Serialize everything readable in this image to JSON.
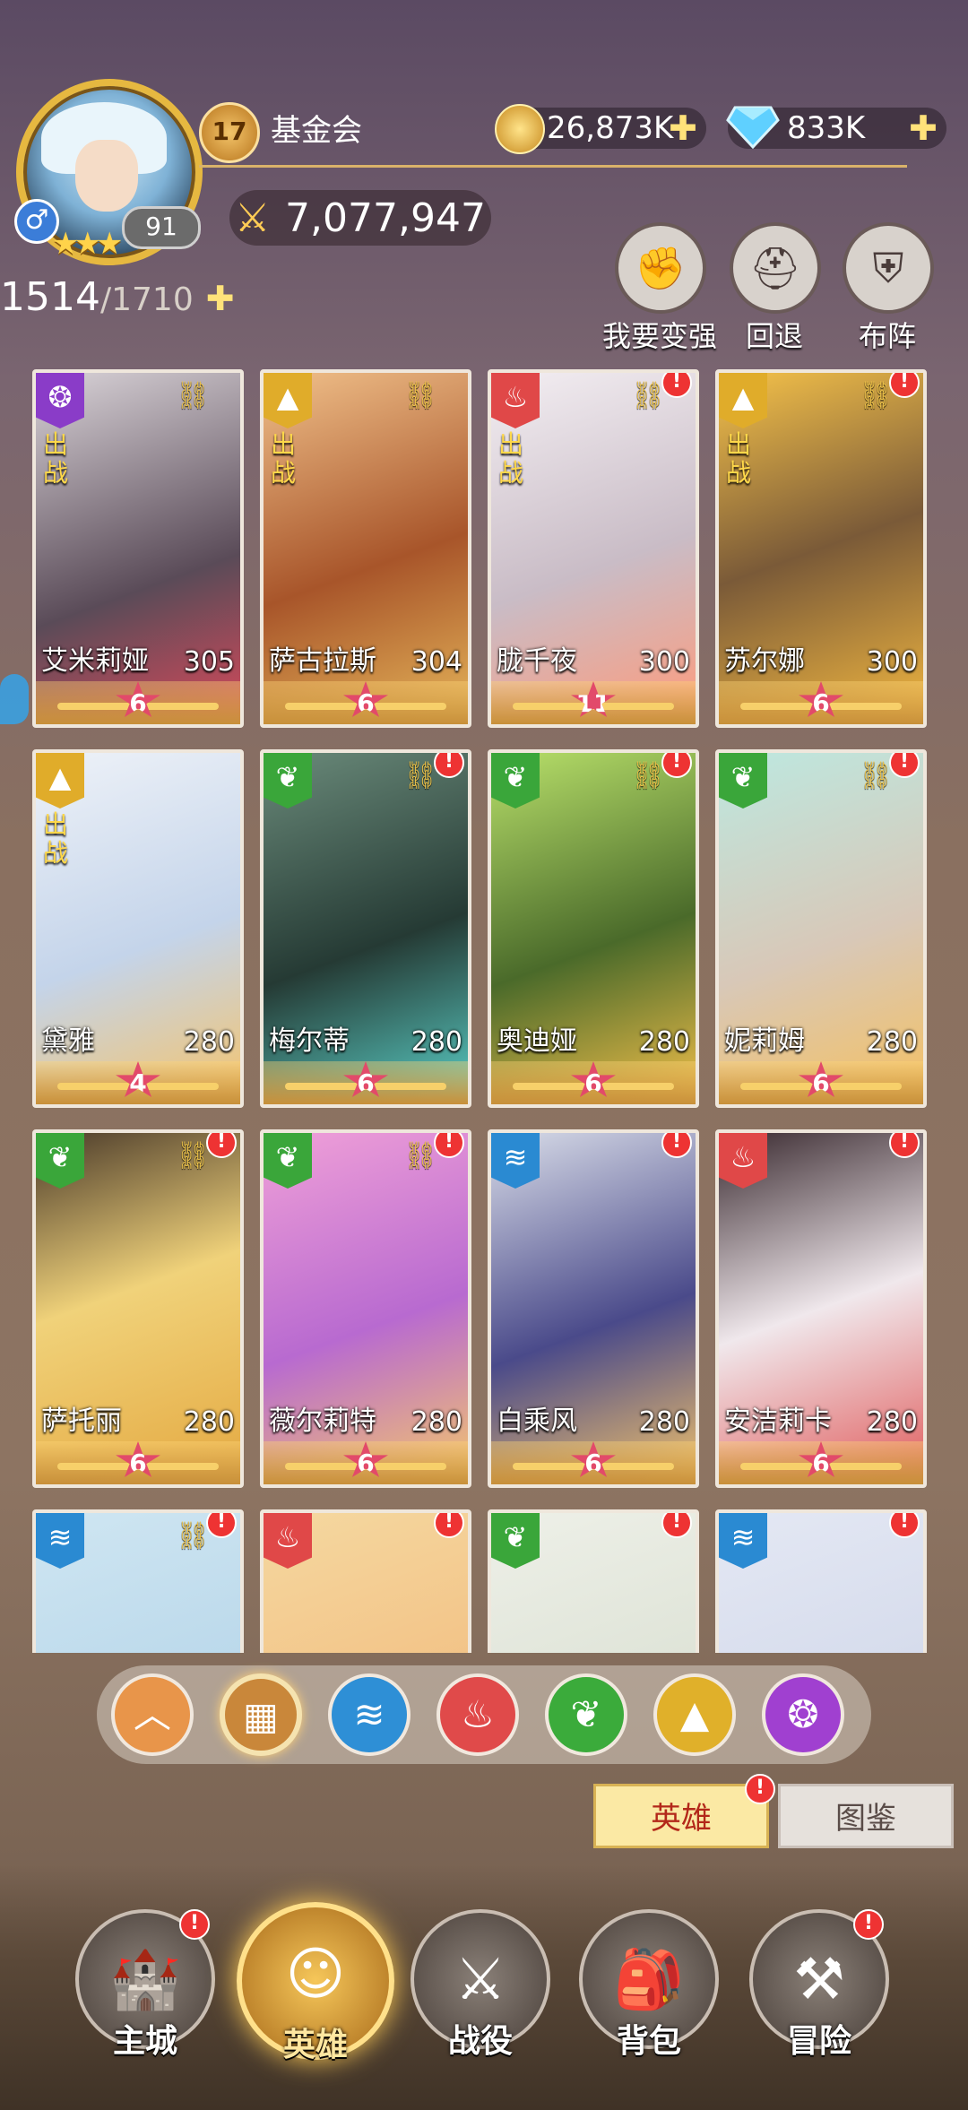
{
  "player": {
    "level": "91",
    "vip_level": "17",
    "guild": "基金会",
    "power": "7,077,947",
    "gender_icon": "male-icon"
  },
  "resources": {
    "gold": "26,873K",
    "gems": "833K"
  },
  "actions": [
    {
      "label": "我要变强",
      "icon": "fist-icon"
    },
    {
      "label": "回退",
      "icon": "helmet-reset-icon"
    },
    {
      "label": "布阵",
      "icon": "formation-shield-icon"
    }
  ],
  "capacity": {
    "current": "1514",
    "max": "/1710"
  },
  "deploy_label": "出战",
  "heroes": [
    {
      "name": "艾米莉娅",
      "level": "305",
      "stars": "6",
      "element": "dark",
      "deployed": true,
      "alert": false,
      "linked": true
    },
    {
      "name": "萨古拉斯",
      "level": "304",
      "stars": "6",
      "element": "light",
      "deployed": true,
      "alert": false,
      "linked": true
    },
    {
      "name": "胧千夜",
      "level": "300",
      "stars": "11",
      "element": "fire",
      "deployed": true,
      "alert": true,
      "linked": true
    },
    {
      "name": "苏尔娜",
      "level": "300",
      "stars": "6",
      "element": "light",
      "deployed": true,
      "alert": true,
      "linked": true
    },
    {
      "name": "黛雅",
      "level": "280",
      "stars": "4",
      "element": "light",
      "deployed": true,
      "alert": false,
      "linked": false
    },
    {
      "name": "梅尔蒂",
      "level": "280",
      "stars": "6",
      "element": "nature",
      "deployed": false,
      "alert": true,
      "linked": true
    },
    {
      "name": "奥迪娅",
      "level": "280",
      "stars": "6",
      "element": "nature",
      "deployed": false,
      "alert": true,
      "linked": true
    },
    {
      "name": "妮莉姆",
      "level": "280",
      "stars": "6",
      "element": "nature",
      "deployed": false,
      "alert": true,
      "linked": true
    },
    {
      "name": "萨托丽",
      "level": "280",
      "stars": "6",
      "element": "nature",
      "deployed": false,
      "alert": true,
      "linked": true
    },
    {
      "name": "薇尔莉特",
      "level": "280",
      "stars": "6",
      "element": "nature",
      "deployed": false,
      "alert": true,
      "linked": true
    },
    {
      "name": "白乘风",
      "level": "280",
      "stars": "6",
      "element": "water",
      "deployed": false,
      "alert": true,
      "linked": false
    },
    {
      "name": "安洁莉卡",
      "level": "280",
      "stars": "6",
      "element": "fire",
      "deployed": false,
      "alert": true,
      "linked": false
    },
    {
      "name": "",
      "level": "",
      "stars": "",
      "element": "water",
      "deployed": false,
      "alert": true,
      "linked": true
    },
    {
      "name": "",
      "level": "",
      "stars": "",
      "element": "fire",
      "deployed": false,
      "alert": true,
      "linked": false
    },
    {
      "name": "",
      "level": "",
      "stars": "",
      "element": "nature",
      "deployed": false,
      "alert": true,
      "linked": false
    },
    {
      "name": "",
      "level": "",
      "stars": "",
      "element": "water",
      "deployed": false,
      "alert": true,
      "linked": false
    }
  ],
  "filters": [
    {
      "icon": "chevron-up-icon",
      "color": "#e8954a"
    },
    {
      "icon": "grid-all-icon",
      "color": "#c9873a"
    },
    {
      "icon": "water-element-icon",
      "color": "#2e8fd6"
    },
    {
      "icon": "fire-element-icon",
      "color": "#e04a4a"
    },
    {
      "icon": "nature-element-icon",
      "color": "#3bab3b"
    },
    {
      "icon": "light-element-icon",
      "color": "#e0b02a"
    },
    {
      "icon": "dark-element-icon",
      "color": "#a040d0"
    }
  ],
  "tabs": {
    "hero": "英雄",
    "dex": "图鉴"
  },
  "nav": [
    {
      "label": "主城",
      "icon": "castle-icon",
      "alert": true
    },
    {
      "label": "英雄",
      "icon": "hero-icon",
      "alert": false,
      "active": true
    },
    {
      "label": "战役",
      "icon": "sword-wings-icon",
      "alert": false
    },
    {
      "label": "背包",
      "icon": "backpack-icon",
      "alert": false
    },
    {
      "label": "冒险",
      "icon": "sword-hammer-icon",
      "alert": true
    }
  ],
  "element_colors": {
    "dark": "#8a3cc8",
    "light": "#e0ac2a",
    "fire": "#e04848",
    "nature": "#3aa63a",
    "water": "#2a8ad2"
  }
}
